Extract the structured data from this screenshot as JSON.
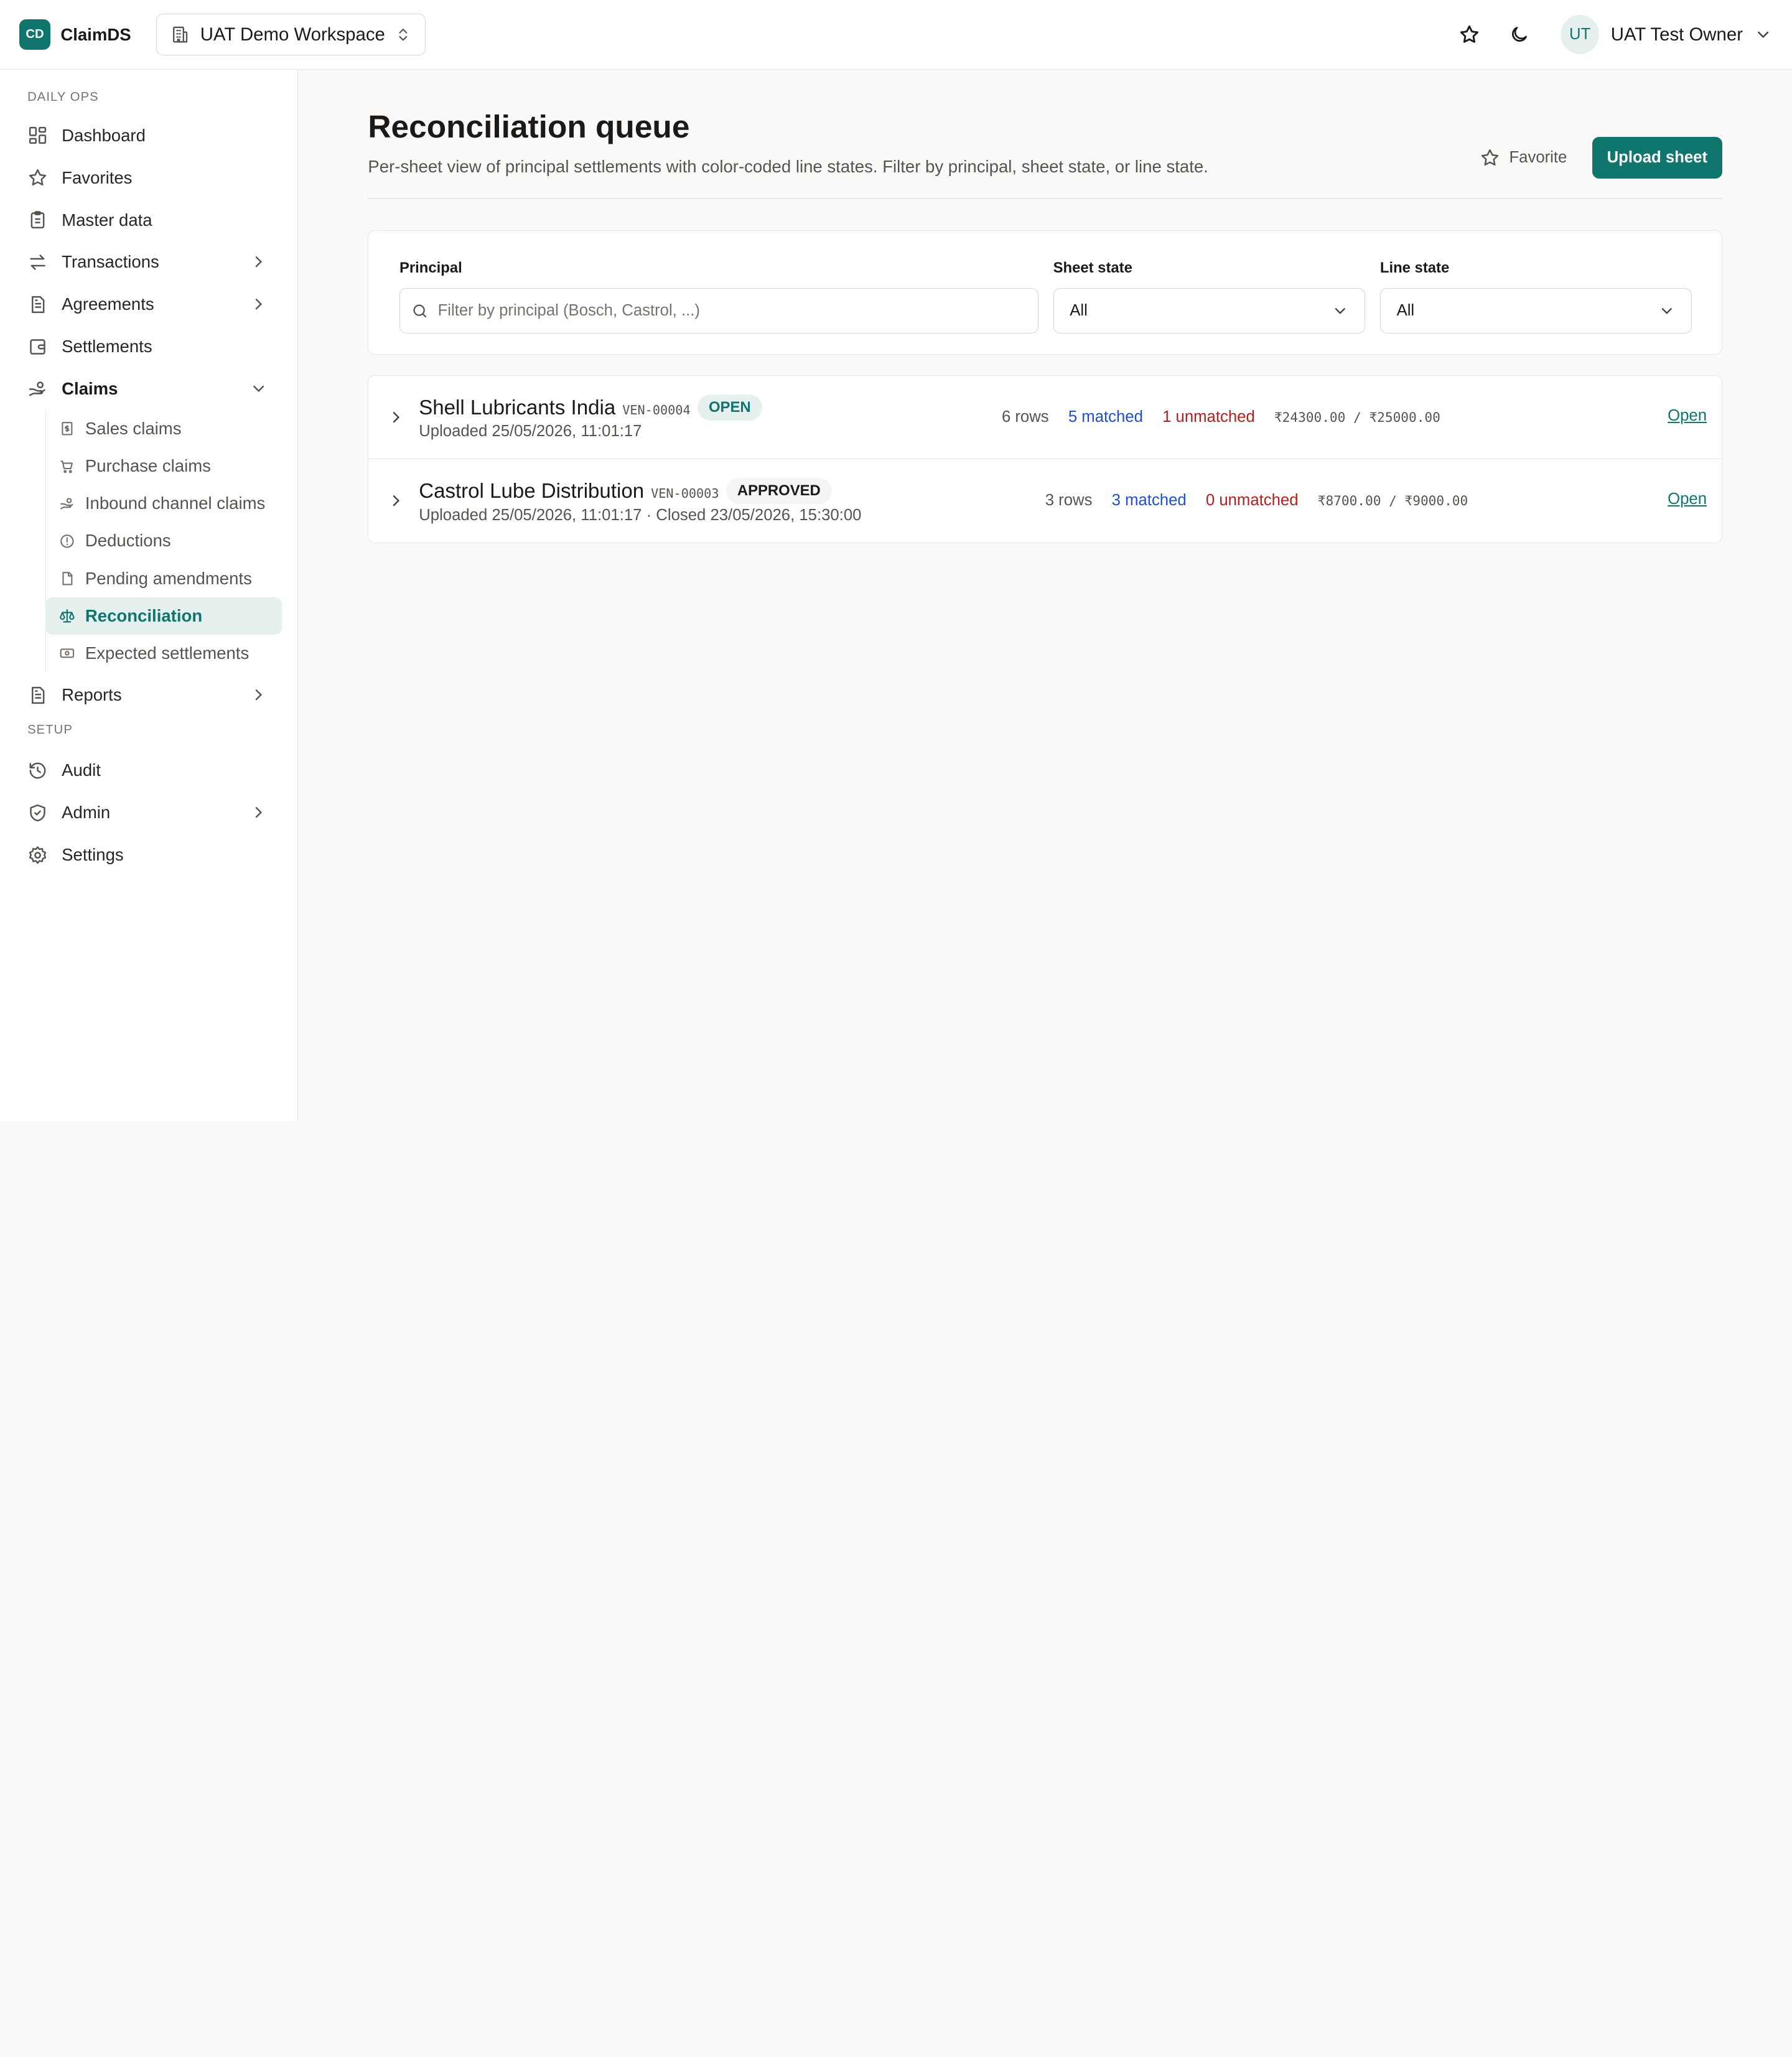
{
  "header": {
    "logo_text": "CD",
    "brand": "ClaimDS",
    "workspace": "UAT Demo Workspace",
    "user_initials": "UT",
    "user_name": "UAT Test Owner"
  },
  "sidebar": {
    "sections": [
      "DAILY OPS",
      "SETUP"
    ],
    "items": [
      {
        "label": "Dashboard",
        "icon": "grid-icon"
      },
      {
        "label": "Favorites",
        "icon": "star-icon"
      },
      {
        "label": "Master data",
        "icon": "clipboard-icon"
      },
      {
        "label": "Transactions",
        "icon": "arrows-swap-icon",
        "expandable": true
      },
      {
        "label": "Agreements",
        "icon": "document-icon",
        "expandable": true
      },
      {
        "label": "Settlements",
        "icon": "wallet-icon"
      },
      {
        "label": "Claims",
        "icon": "hand-coins-icon",
        "expanded": true
      },
      {
        "label": "Reports",
        "icon": "report-icon",
        "expandable": true
      },
      {
        "label": "Audit",
        "icon": "history-icon"
      },
      {
        "label": "Admin",
        "icon": "shield-icon",
        "expandable": true
      },
      {
        "label": "Settings",
        "icon": "gear-icon"
      }
    ],
    "claims_sub": [
      {
        "label": "Sales claims",
        "icon": "receipt-icon"
      },
      {
        "label": "Purchase claims",
        "icon": "cart-icon"
      },
      {
        "label": "Inbound channel claims",
        "icon": "hand-coins-icon"
      },
      {
        "label": "Deductions",
        "icon": "alert-circle-icon"
      },
      {
        "label": "Pending amendments",
        "icon": "file-icon"
      },
      {
        "label": "Reconciliation",
        "icon": "scale-icon",
        "active": true
      },
      {
        "label": "Expected settlements",
        "icon": "banknote-icon"
      }
    ]
  },
  "page": {
    "title": "Reconciliation queue",
    "subtitle": "Per-sheet view of principal settlements with color-coded line states. Filter by principal, sheet state, or line state.",
    "favorite_label": "Favorite",
    "upload_label": "Upload sheet"
  },
  "filters": {
    "principal_label": "Principal",
    "principal_placeholder": "Filter by principal (Bosch, Castrol, ...)",
    "sheet_state_label": "Sheet state",
    "sheet_state_value": "All",
    "line_state_label": "Line state",
    "line_state_value": "All"
  },
  "sheets": [
    {
      "name": "Shell Lubricants India",
      "code": "VEN-00004",
      "status": "OPEN",
      "uploaded": "Uploaded 25/05/2026, 11:01:17",
      "rows": "6 rows",
      "matched": "5 matched",
      "unmatched": "1 unmatched",
      "amounts": "₹24300.00 / ₹25000.00",
      "action": "Open"
    },
    {
      "name": "Castrol Lube Distribution",
      "code": "VEN-00003",
      "status": "APPROVED",
      "uploaded": "Uploaded 25/05/2026, 11:01:17 · Closed 23/05/2026, 15:30:00",
      "rows": "3 rows",
      "matched": "3 matched",
      "unmatched": "0 unmatched",
      "amounts": "₹8700.00 / ₹9000.00",
      "action": "Open"
    }
  ],
  "colors": {
    "accent": "#0f766e",
    "matched": "#1d4ed8",
    "unmatched": "#b91c1c"
  }
}
